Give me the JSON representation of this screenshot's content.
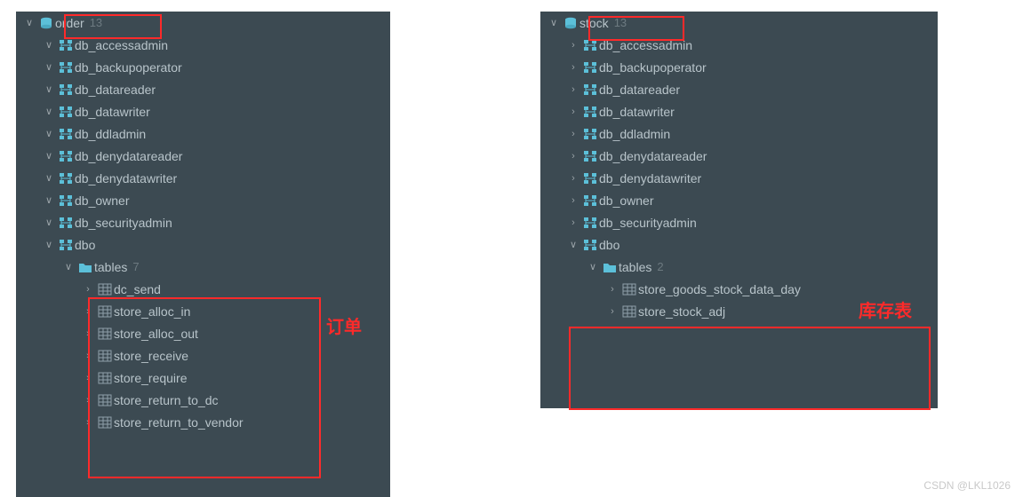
{
  "left": {
    "root": {
      "name": "order",
      "count": "13"
    },
    "schemas": [
      "db_accessadmin",
      "db_backupoperator",
      "db_datareader",
      "db_datawriter",
      "db_ddladmin",
      "db_denydatareader",
      "db_denydatawriter",
      "db_owner",
      "db_securityadmin"
    ],
    "dbo_label": "dbo",
    "tables_label": "tables",
    "tables_count": "7",
    "tables": [
      "dc_send",
      "store_alloc_in",
      "store_alloc_out",
      "store_receive",
      "store_require",
      "store_return_to_dc",
      "store_return_to_vendor"
    ],
    "annotation": "订单"
  },
  "right": {
    "root": {
      "name": "stock",
      "count": "13"
    },
    "schemas": [
      "db_accessadmin",
      "db_backupoperator",
      "db_datareader",
      "db_datawriter",
      "db_ddladmin",
      "db_denydatareader",
      "db_denydatawriter",
      "db_owner",
      "db_securityadmin"
    ],
    "dbo_label": "dbo",
    "tables_label": "tables",
    "tables_count": "2",
    "tables": [
      "store_goods_stock_data_day",
      "store_stock_adj"
    ],
    "annotation": "库存表"
  },
  "watermark": "CSDN @LKL1026"
}
